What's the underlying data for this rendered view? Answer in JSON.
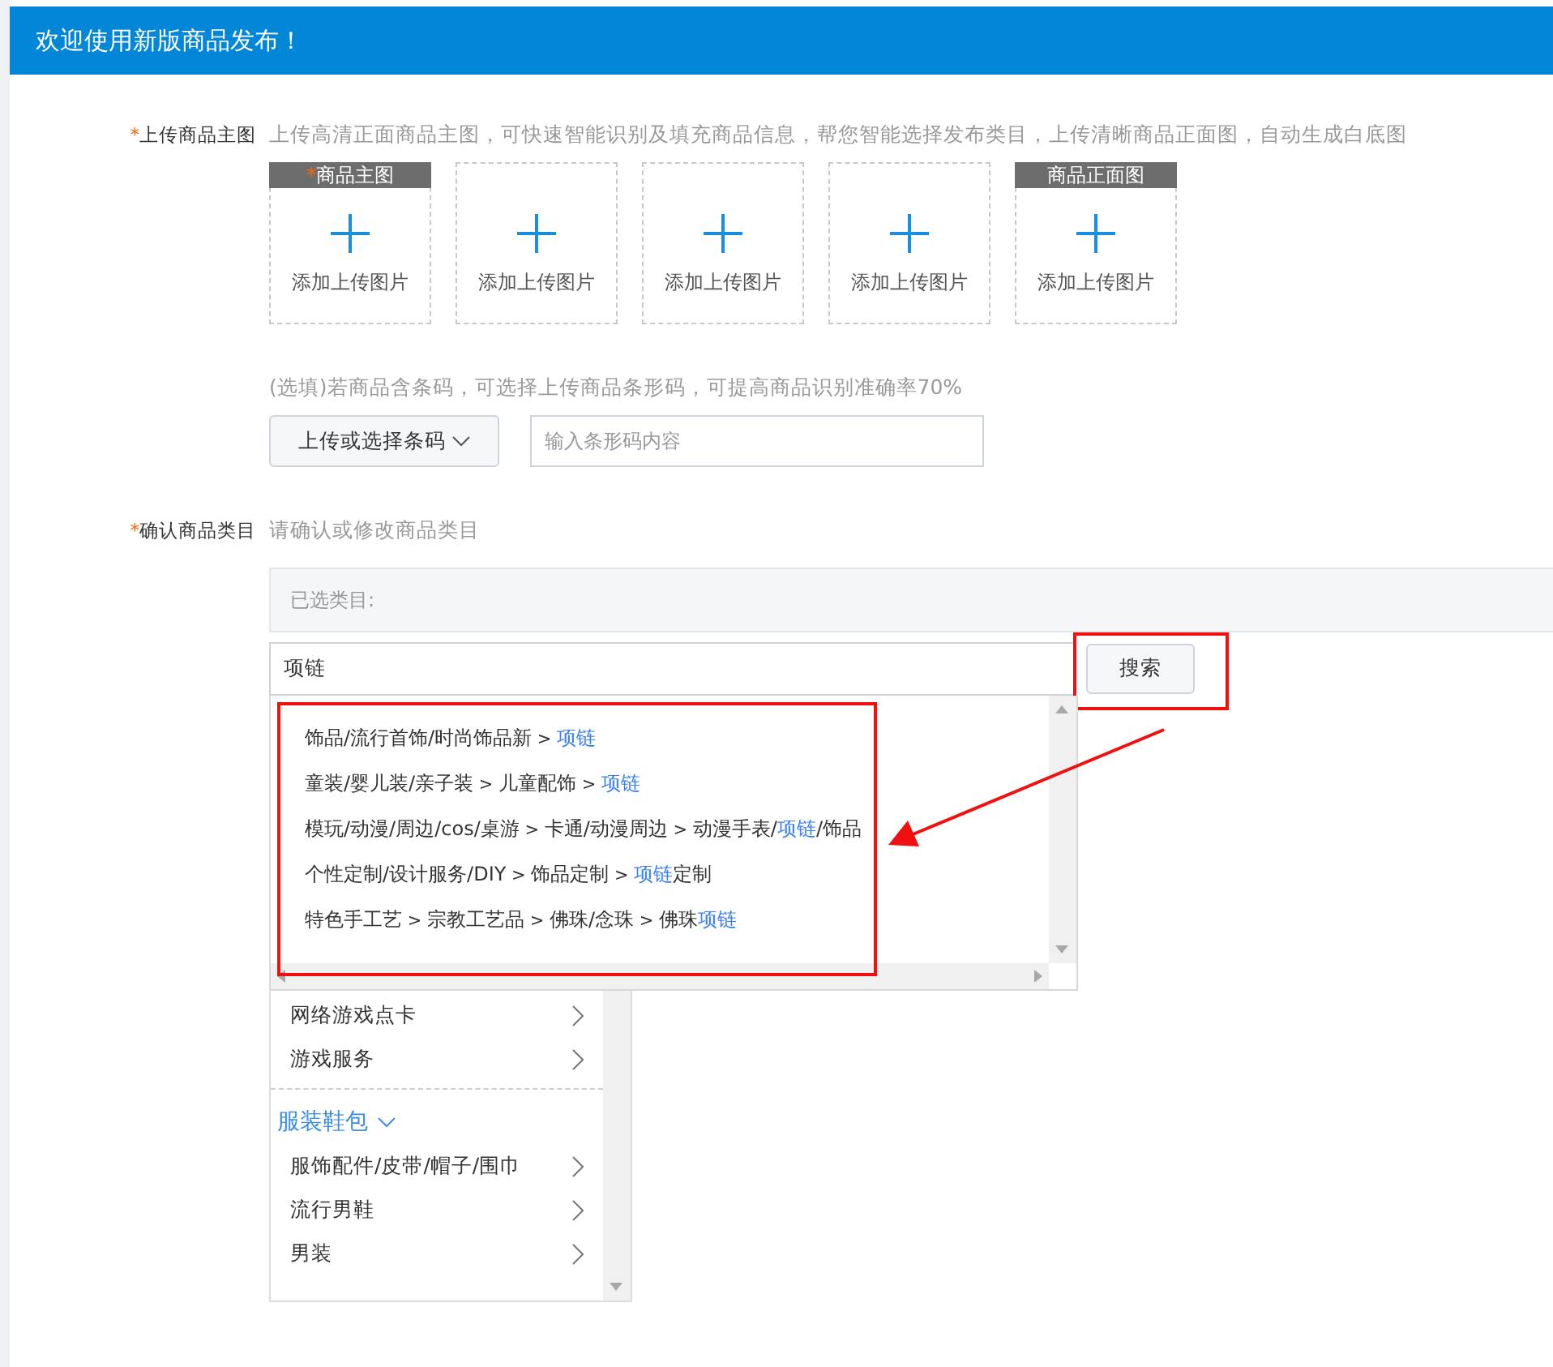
{
  "header": {
    "title": "欢迎使用新版商品发布！"
  },
  "main_image": {
    "label": "上传商品主图",
    "required_mark": "*",
    "hint": "上传高清正面商品主图，可快速智能识别及填充商品信息，帮您智能选择发布类目，上传清晰商品正面图，自动生成白底图",
    "slots": [
      {
        "tag": "商品主图",
        "tag_mark": "*",
        "text": "添加上传图片"
      },
      {
        "text": "添加上传图片"
      },
      {
        "text": "添加上传图片"
      },
      {
        "text": "添加上传图片"
      },
      {
        "tag": "商品正面图",
        "text": "添加上传图片"
      }
    ]
  },
  "barcode": {
    "hint": "(选填)若商品含条码，可选择上传商品条形码，可提高商品识别准确率70%",
    "button": "上传或选择条码",
    "placeholder": "输入条形码内容"
  },
  "category": {
    "label": "确认商品类目",
    "required_mark": "*",
    "hint": "请确认或修改商品类目",
    "selected_label": "已选类目:",
    "search_value": "项链",
    "search_button": "搜索",
    "search_button_highlighted": true,
    "suggestions_highlighted": true,
    "suggestions": [
      [
        {
          "text": "饰品/流行首饰/时尚饰品新"
        },
        {
          "text": " > ",
          "kind": "sep"
        },
        {
          "text": "项链",
          "kind": "match"
        }
      ],
      [
        {
          "text": "童装/婴儿装/亲子装"
        },
        {
          "text": " > ",
          "kind": "sep"
        },
        {
          "text": "儿童配饰"
        },
        {
          "text": " > ",
          "kind": "sep"
        },
        {
          "text": "项链",
          "kind": "match"
        }
      ],
      [
        {
          "text": "模玩/动漫/周边/cos/桌游"
        },
        {
          "text": " > ",
          "kind": "sep"
        },
        {
          "text": "卡通/动漫周边"
        },
        {
          "text": " > ",
          "kind": "sep"
        },
        {
          "text": "动漫手表/"
        },
        {
          "text": "项链",
          "kind": "match"
        },
        {
          "text": "/饰品"
        }
      ],
      [
        {
          "text": "个性定制/设计服务/DIY"
        },
        {
          "text": " > ",
          "kind": "sep"
        },
        {
          "text": "饰品定制"
        },
        {
          "text": " > ",
          "kind": "sep"
        },
        {
          "text": "项链",
          "kind": "match"
        },
        {
          "text": "定制"
        }
      ],
      [
        {
          "text": "特色手工艺"
        },
        {
          "text": " > ",
          "kind": "sep"
        },
        {
          "text": "宗教工艺品"
        },
        {
          "text": " > ",
          "kind": "sep"
        },
        {
          "text": "佛珠/念珠"
        },
        {
          "text": " > ",
          "kind": "sep"
        },
        {
          "text": "佛珠"
        },
        {
          "text": "项链",
          "kind": "match"
        }
      ]
    ],
    "list": [
      {
        "kind": "item",
        "text": "网络游戏点卡"
      },
      {
        "kind": "item",
        "text": "游戏服务"
      },
      {
        "kind": "divider"
      },
      {
        "kind": "group",
        "text": "服装鞋包",
        "expanded": true
      },
      {
        "kind": "item",
        "text": "服饰配件/皮带/帽子/围巾"
      },
      {
        "kind": "item",
        "text": "流行男鞋"
      },
      {
        "kind": "item",
        "text": "男装"
      }
    ]
  },
  "annotation_arrow": true
}
